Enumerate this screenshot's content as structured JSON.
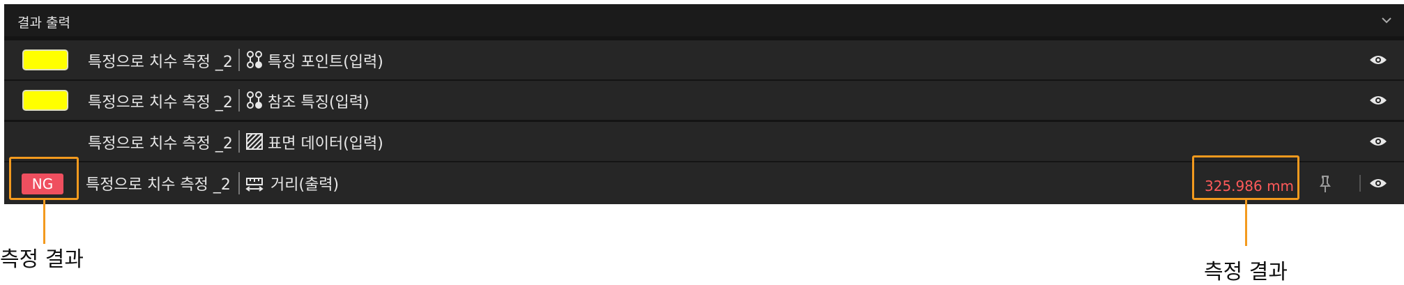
{
  "panel": {
    "title": "결과 출력"
  },
  "rows": [
    {
      "label": "특정으로 치수 측정 _2",
      "type_icon": "feature-nodes-icon",
      "type_label": "특징 포인트(입력)",
      "swatch_color": "#ffff00"
    },
    {
      "label": "특정으로 치수 측정 _2",
      "type_icon": "feature-nodes-icon",
      "type_label": "참조 특징(입력)",
      "swatch_color": "#ffff00"
    },
    {
      "label": "특정으로 치수 측정 _2",
      "type_icon": "surface-hatch-icon",
      "type_label": "표면 데이터(입력)"
    },
    {
      "label": "특정으로 치수 측정 _2",
      "type_icon": "distance-icon",
      "type_label": "거리(출력)",
      "status": "NG",
      "value": "325.986 mm",
      "status_color": "#ef4f5f"
    }
  ],
  "annotations": {
    "left": "측정 결과",
    "right": "측정 결과"
  },
  "colors": {
    "accent": "#f39a1e",
    "ng": "#ef4f5f",
    "value": "#ff5a5a",
    "swatch": "#ffff00"
  }
}
